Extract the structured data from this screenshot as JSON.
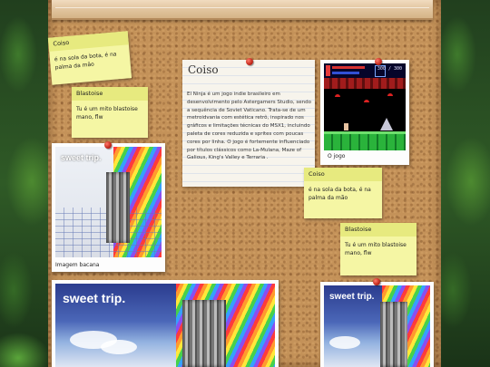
{
  "sticky_notes": [
    {
      "title": "Coiso",
      "body": "é na sola da bota, é na palma da mão"
    },
    {
      "title": "Blastoise",
      "body": "Tu é um mito blastoise mano, flw"
    },
    {
      "title": "Coiso",
      "body": "é na sola da bota, é na palma da mão"
    },
    {
      "title": "Blastoise",
      "body": "Tu é um mito blastoise mano, flw"
    }
  ],
  "main_note": {
    "title": "Coiso",
    "body": "El Ninja é um jogo indie brasileiro em desenvolvimento pelo Astergamers Studio, sendo a sequência de Soviet Vaticano. Trata-se de um metroidvania com estética retrô, inspirado nos gráficos e limitações técnicas do MSX1, incluindo paleta de cores reduzida e sprites com poucas cores por linha. O jogo é fortemente influenciado por títulos clássicos como La-Mulana, Maze of Galious, King's Valley e Terraria ."
  },
  "photos": [
    {
      "caption": "O jogo",
      "art": "game-screenshot"
    },
    {
      "caption": "Imagem bacana",
      "art": "album-cover",
      "brand": "sweet trip."
    },
    {
      "caption": "",
      "art": "album-cover",
      "brand": "sweet trip."
    },
    {
      "caption": "",
      "art": "album-cover",
      "brand": "sweet trip."
    }
  ],
  "game_hud": {
    "score": "300 / 300"
  },
  "colors": {
    "pin": "#c2261a",
    "sticky": "#f5f6a4",
    "cork": "#c49259"
  }
}
